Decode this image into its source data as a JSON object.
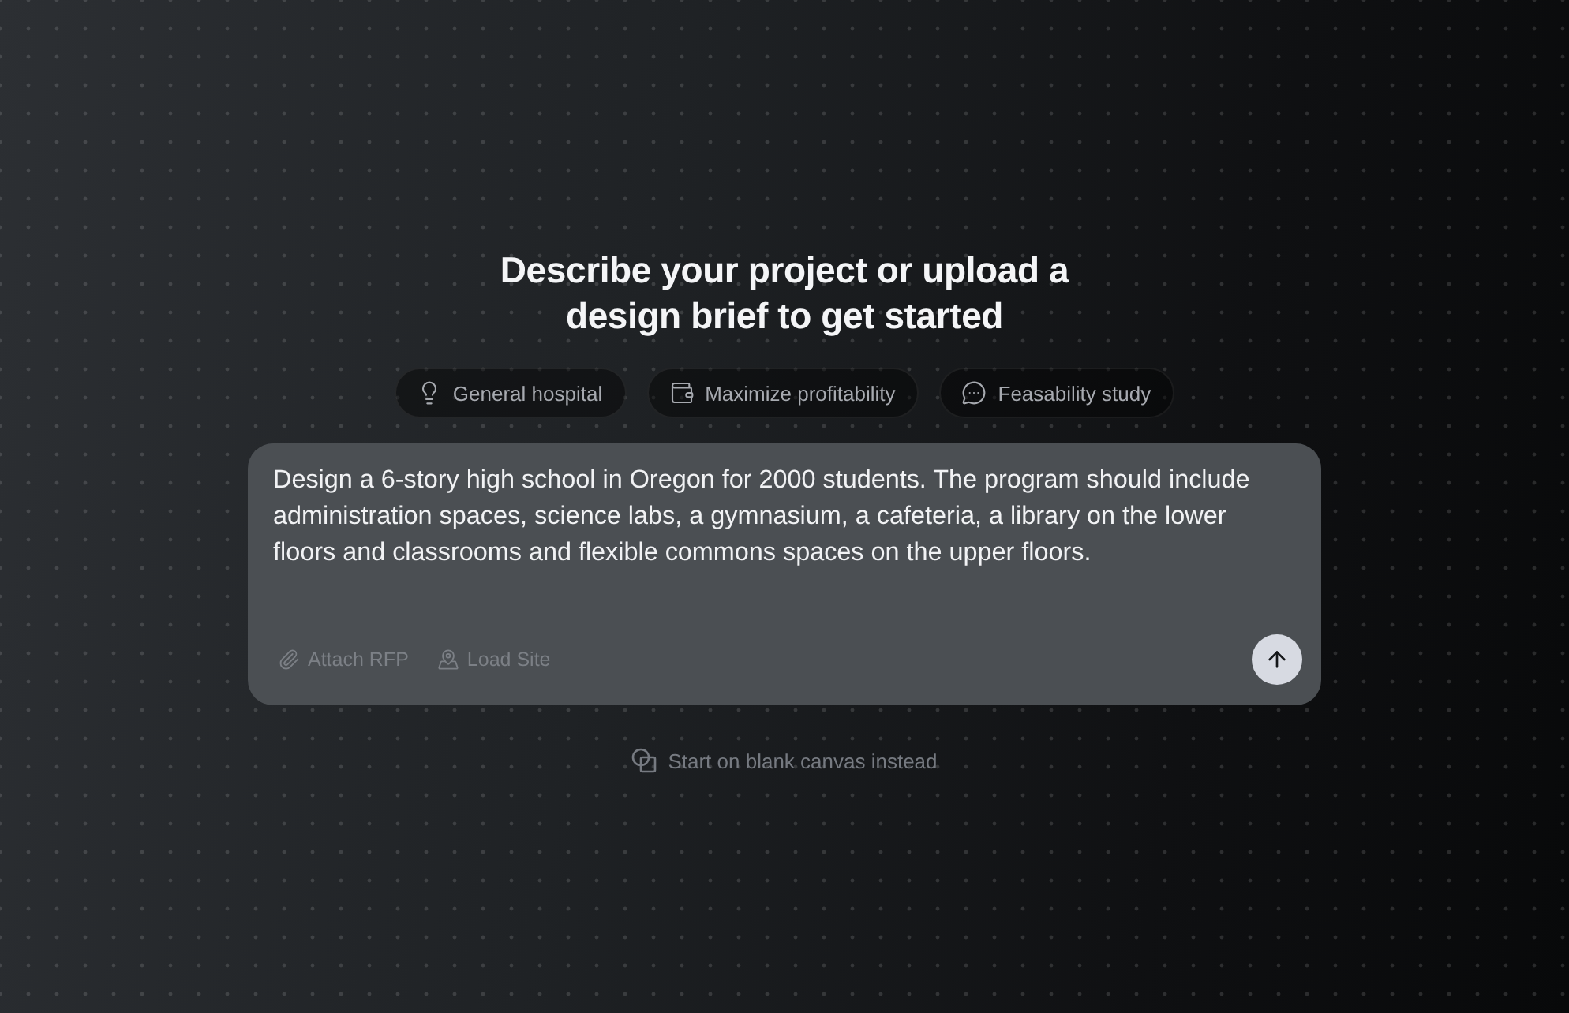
{
  "heading": "Describe your project or upload a design brief to get started",
  "suggestions": [
    {
      "label": "General hospital"
    },
    {
      "label": "Maximize profitability"
    },
    {
      "label": "Feasability study"
    }
  ],
  "prompt": {
    "value": "Design a 6-story high school in Oregon for 2000 students. The program should include administration spaces, science labs, a gymnasium, a cafeteria, a library on the lower floors and classrooms and flexible commons spaces on the upper floors."
  },
  "actions": [
    {
      "label": "Attach RFP"
    },
    {
      "label": "Load Site"
    }
  ],
  "blank_canvas_link": "Start on blank canvas instead"
}
